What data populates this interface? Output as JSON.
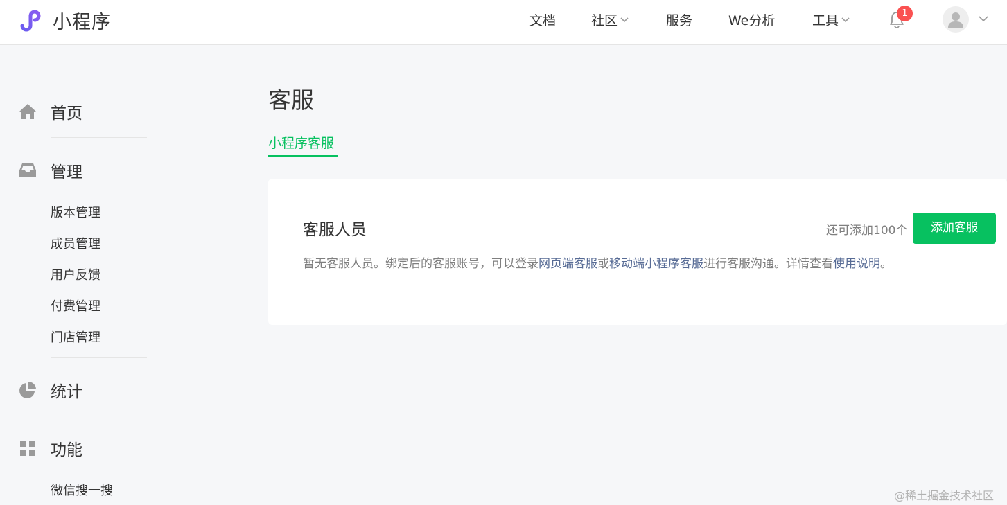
{
  "header": {
    "app_name": "小程序",
    "nav": [
      {
        "label": "文档",
        "has_dropdown": false
      },
      {
        "label": "社区",
        "has_dropdown": true
      },
      {
        "label": "服务",
        "has_dropdown": false
      },
      {
        "label": "We分析",
        "has_dropdown": false
      },
      {
        "label": "工具",
        "has_dropdown": true
      }
    ],
    "notification_count": "1",
    "icons": [
      "logo-icon",
      "bell-icon",
      "avatar-icon",
      "chevron-down-icon"
    ]
  },
  "sidebar": {
    "sections": [
      {
        "label": "首页",
        "icon": "home-icon"
      },
      {
        "label": "管理",
        "icon": "inbox-icon",
        "items": [
          "版本管理",
          "成员管理",
          "用户反馈",
          "付费管理",
          "门店管理"
        ]
      },
      {
        "label": "统计",
        "icon": "pie-chart-icon"
      },
      {
        "label": "功能",
        "icon": "grid-icon",
        "items": [
          "微信搜一搜"
        ]
      }
    ]
  },
  "main": {
    "title": "客服",
    "tabs": [
      {
        "label": "小程序客服",
        "active": true
      }
    ],
    "card": {
      "title": "客服人员",
      "quota_text": "还可添加100个",
      "add_button": "添加客服",
      "desc_prefix": "暂无客服人员。绑定后的客服账号，可以登录",
      "link_web": "网页端客服",
      "desc_or": "或",
      "link_mobile": "移动端小程序客服",
      "desc_middle": "进行客服沟通。详情查看",
      "link_help": "使用说明",
      "desc_end": "。"
    }
  },
  "watermark": "@稀土掘金技术社区",
  "colors": {
    "accent": "#07c160",
    "link": "#576b95",
    "badge": "#fa5151",
    "logo": "#6467f0",
    "background": "#f6f7f9"
  }
}
